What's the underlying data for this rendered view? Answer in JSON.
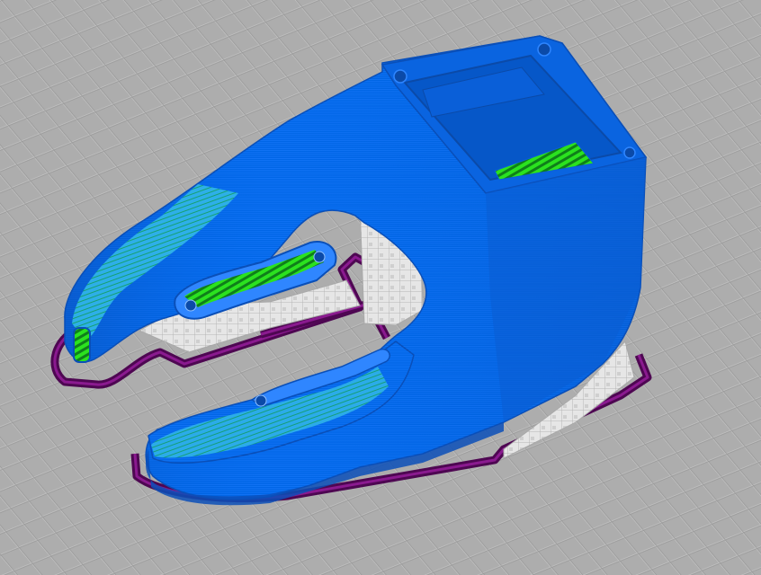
{
  "viewport": {
    "type": "3d-print-slicer-preview",
    "view": "perspective",
    "layer_view": "sliced-toolpaths"
  },
  "colors": {
    "build_plate": "#aeaeae",
    "grid_line": "#bdbdbd",
    "grid_shadow": "#8f8f8f",
    "wall": "#0066e6",
    "wall_dark": "#0a4fb8",
    "wall_light": "#2f86ff",
    "skin_light": "#39c6f2",
    "skin_stripe": "#1ab86e",
    "infill": "#22e01a",
    "infill_dark": "#0d8f14",
    "skirt": "#5a0a5e",
    "skirt_inner": "#8a1a8f",
    "support": "#e4e4e4",
    "support_shade": "#bcbcbc"
  },
  "features": [
    "skirt-brim",
    "support-structure",
    "outer-wall",
    "top-bottom-skin",
    "infill"
  ]
}
